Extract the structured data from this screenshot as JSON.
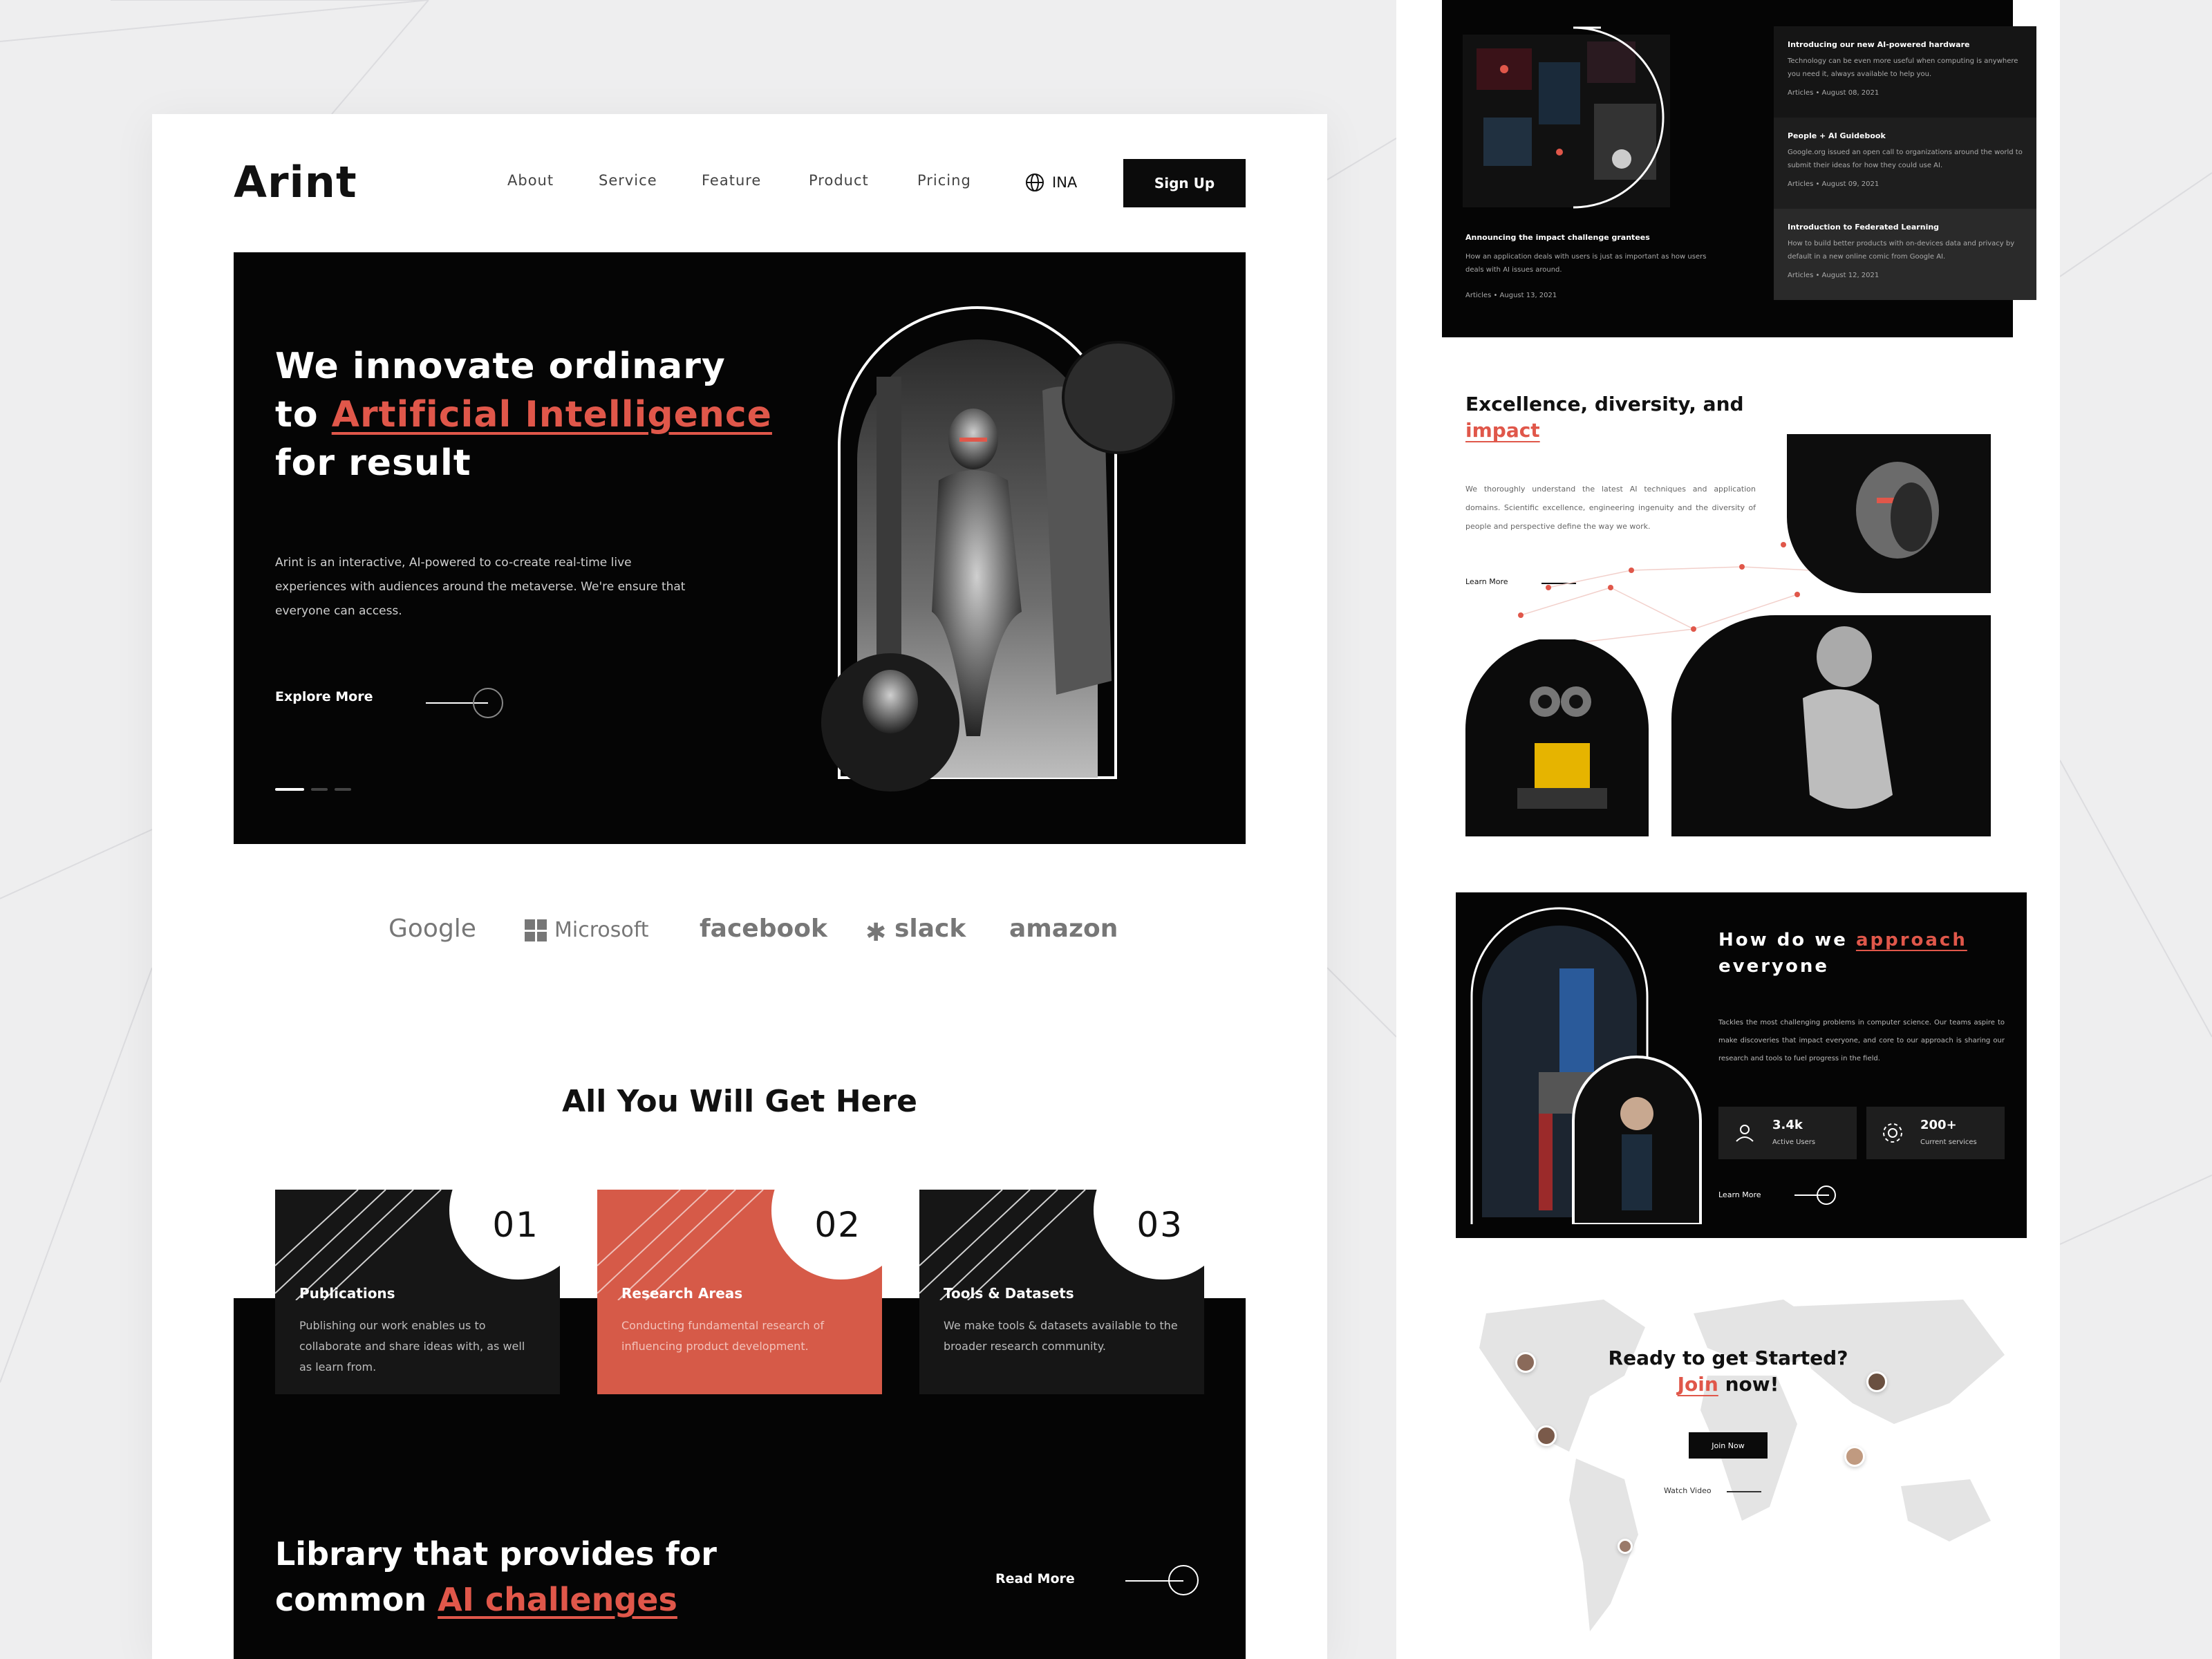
{
  "site": {
    "logo": "Arint",
    "nav": [
      "About",
      "Service",
      "Feature",
      "Product",
      "Pricing"
    ],
    "language": "INA",
    "signup": "Sign Up"
  },
  "hero": {
    "title_line1": "We innovate ordinary",
    "title_to": "to",
    "title_highlight": "Artificial Intelligence",
    "title_line3": "for result",
    "description": "Arint is an interactive, AI-powered to co-create real-time live experiences with audiences around the metaverse. We're ensure that everyone can access.",
    "cta": "Explore More"
  },
  "brands": [
    "Google",
    "Microsoft",
    "facebook",
    "slack",
    "amazon"
  ],
  "features": {
    "title": "All You Will Get Here",
    "cards": [
      {
        "num": "01",
        "title": "Publications",
        "desc": "Publishing our work enables us to collaborate and share ideas with, as well as learn from.",
        "bg": "#161616"
      },
      {
        "num": "02",
        "title": "Research Areas",
        "desc": "Conducting fundamental research of influencing product development.",
        "bg": "#d65a48"
      },
      {
        "num": "03",
        "title": "Tools & Datasets",
        "desc": "We make tools & datasets available to the broader research community.",
        "bg": "#161616"
      }
    ]
  },
  "library": {
    "line1": "Library that provides for",
    "line2_pre": "common",
    "line2_highlight": "AI challenges",
    "cta": "Read More"
  },
  "news": {
    "feature_title": "Announcing the impact challenge grantees",
    "feature_desc": "How an application deals with users is just as important as how users deals with AI issues around.",
    "feature_meta": "Articles  •  August 13, 2021",
    "articles": [
      {
        "title": "Introducing our new AI-powered hardware",
        "desc": "Technology can be even more useful when computing is anywhere you need it, always available to help you.",
        "meta": "Articles  •  August 08, 2021"
      },
      {
        "title": "People + AI Guidebook",
        "desc": "Google.org issued an open call to organizations around the world to submit their ideas for how they could use AI.",
        "meta": "Articles  •  August 09, 2021"
      },
      {
        "title": "Introduction to Federated Learning",
        "desc": "How to build better products with on-devices data and privacy by default in a new online comic from Google AI.",
        "meta": "Articles  •  August 12, 2021"
      }
    ]
  },
  "excellence": {
    "title_line1": "Excellence, diversity, and",
    "title_highlight": "impact",
    "desc": "We thoroughly understand the latest AI techniques and application domains. Scientific excellence, engineering ingenuity and the diversity of people and perspective define the way we work.",
    "cta": "Learn More"
  },
  "approach": {
    "title_pre": "How do we",
    "title_highlight": "approach",
    "title_post": "everyone",
    "desc": "Tackles the most challenging problems in computer science. Our teams aspire to make discoveries that impact everyone, and core to our approach is sharing our research and tools to fuel progress in the field.",
    "stats": [
      {
        "value": "3.4k",
        "label": "Active Users",
        "icon": "users-icon"
      },
      {
        "value": "200+",
        "label": "Current services",
        "icon": "gear-icon"
      }
    ],
    "cta": "Learn More"
  },
  "cta_section": {
    "title_line1": "Ready to get Started?",
    "title_join": "Join",
    "title_now": "now!",
    "button": "Join Now",
    "video": "Watch Video"
  },
  "colors": {
    "accent": "#e0574a",
    "dark": "#050505"
  }
}
